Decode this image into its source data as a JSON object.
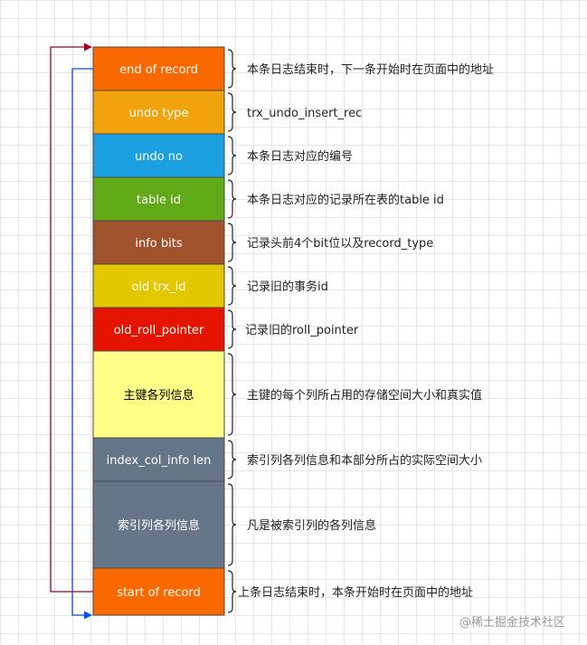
{
  "fields": [
    {
      "label": "end of record",
      "description": "本条日志结束时，下一条开始时在页面中的地址",
      "color": "#fa6800",
      "text_color": "#ffffff"
    },
    {
      "label": "undo type",
      "description": "trx_undo_insert_rec",
      "color": "#f0a30a",
      "text_color": "#ffffff"
    },
    {
      "label": "undo no",
      "description": "本条日志对应的编号",
      "color": "#1ba1e2",
      "text_color": "#ffffff"
    },
    {
      "label": "table id",
      "description": "本条日志对应的记录所在表的table id",
      "color": "#60a917",
      "text_color": "#ffffff"
    },
    {
      "label": "info bits",
      "description": "记录头前4个bit位以及record_type",
      "color": "#a0522d",
      "text_color": "#ffffff"
    },
    {
      "label": "old trx_id",
      "description": "记录旧的事务id",
      "color": "#e3c800",
      "text_color": "#ffffff"
    },
    {
      "label": "old_roll_pointer",
      "description": "记录旧的roll_pointer",
      "color": "#e51400",
      "text_color": "#ffffff"
    },
    {
      "label": "主键各列信息",
      "description": "主键的每个列所占用的存储空间大小和真实值",
      "color": "#ffff88",
      "text_color": "#000000"
    },
    {
      "label": "index_col_info len",
      "description": "索引列各列信息和本部分所占的实际空间大小",
      "color": "#647687",
      "text_color": "#ffffff"
    },
    {
      "label": "索引列各列信息",
      "description": "凡是被索引列的各列信息",
      "color": "#647687",
      "text_color": "#ffffff"
    },
    {
      "label": "start of record",
      "description": "上条日志结束时，本条开始时在页面中的地址",
      "color": "#fa6800",
      "text_color": "#ffffff"
    }
  ],
  "arrows": {
    "to_end_color": "#a20025",
    "to_start_color": "#0050ef"
  },
  "watermark": "@稀土掘金技术社区"
}
